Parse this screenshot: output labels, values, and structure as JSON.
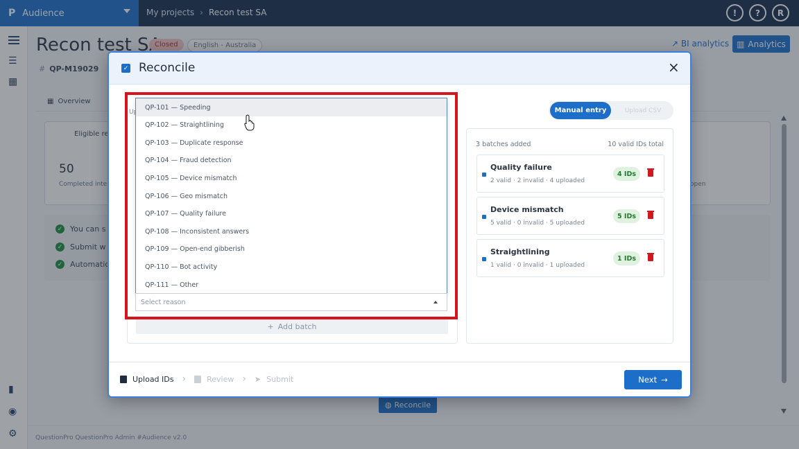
{
  "topbar": {
    "logo": "P",
    "app_name": "Audience",
    "breadcrumb": [
      "My projects",
      "Recon test SA"
    ],
    "feedback_icon": "feedback-icon",
    "help_label": "?",
    "avatar_initial": "R"
  },
  "page": {
    "title": "Recon test SA",
    "status": "Closed",
    "locale": "English - Australia",
    "project_id": "QP-M19029",
    "bi_analytics_label": "BI analytics",
    "analytics_label": "Analytics",
    "tab_overview": "Overview",
    "card_heading": "Eligible res",
    "card_number": "50",
    "card_sub": "Completed inter",
    "card_open": "open",
    "notes": [
      "You can s",
      "Submit w",
      "Automatio"
    ],
    "reconcile_label": "Reconcile",
    "footer": "QuestionPro QuestionPro Admin  #Audience v2.0"
  },
  "modal": {
    "title": "Reconcile",
    "close_label": "×",
    "left_tiny_label": "Up",
    "mode": {
      "active": "Manual entry",
      "inactive": "Upload CSV"
    },
    "dropdown_options": [
      "QP-101 — Speeding",
      "QP-102 — Straightlining",
      "QP-103 — Duplicate response",
      "QP-104 — Fraud detection",
      "QP-105 — Device mismatch",
      "QP-106 — Geo mismatch",
      "QP-107 — Quality failure",
      "QP-108 — Inconsistent answers",
      "QP-109 — Open-end gibberish",
      "QP-110 — Bot activity",
      "QP-111 — Other"
    ],
    "highlighted_option_index": 0,
    "select_placeholder": "Select reason",
    "add_batch_label": "Add batch",
    "summary": "3 batches added",
    "total": "10 valid IDs total",
    "batches": [
      {
        "name": "Quality failure",
        "meta": "2 valid · 2 invalid · 4 uploaded",
        "ids": "4 IDs"
      },
      {
        "name": "Device mismatch",
        "meta": "5 valid · 0 invalid · 5 uploaded",
        "ids": "5 IDs"
      },
      {
        "name": "Straightlining",
        "meta": "1 valid · 0 invalid · 1 uploaded",
        "ids": "1 IDs"
      }
    ],
    "steps": [
      "Upload IDs",
      "Review",
      "Submit"
    ],
    "next_label": "Next"
  },
  "colors": {
    "primary": "#1d6ec9",
    "navbar": "#172d4e",
    "highlight_border": "#d9121c",
    "success": "#1c8d3e"
  }
}
